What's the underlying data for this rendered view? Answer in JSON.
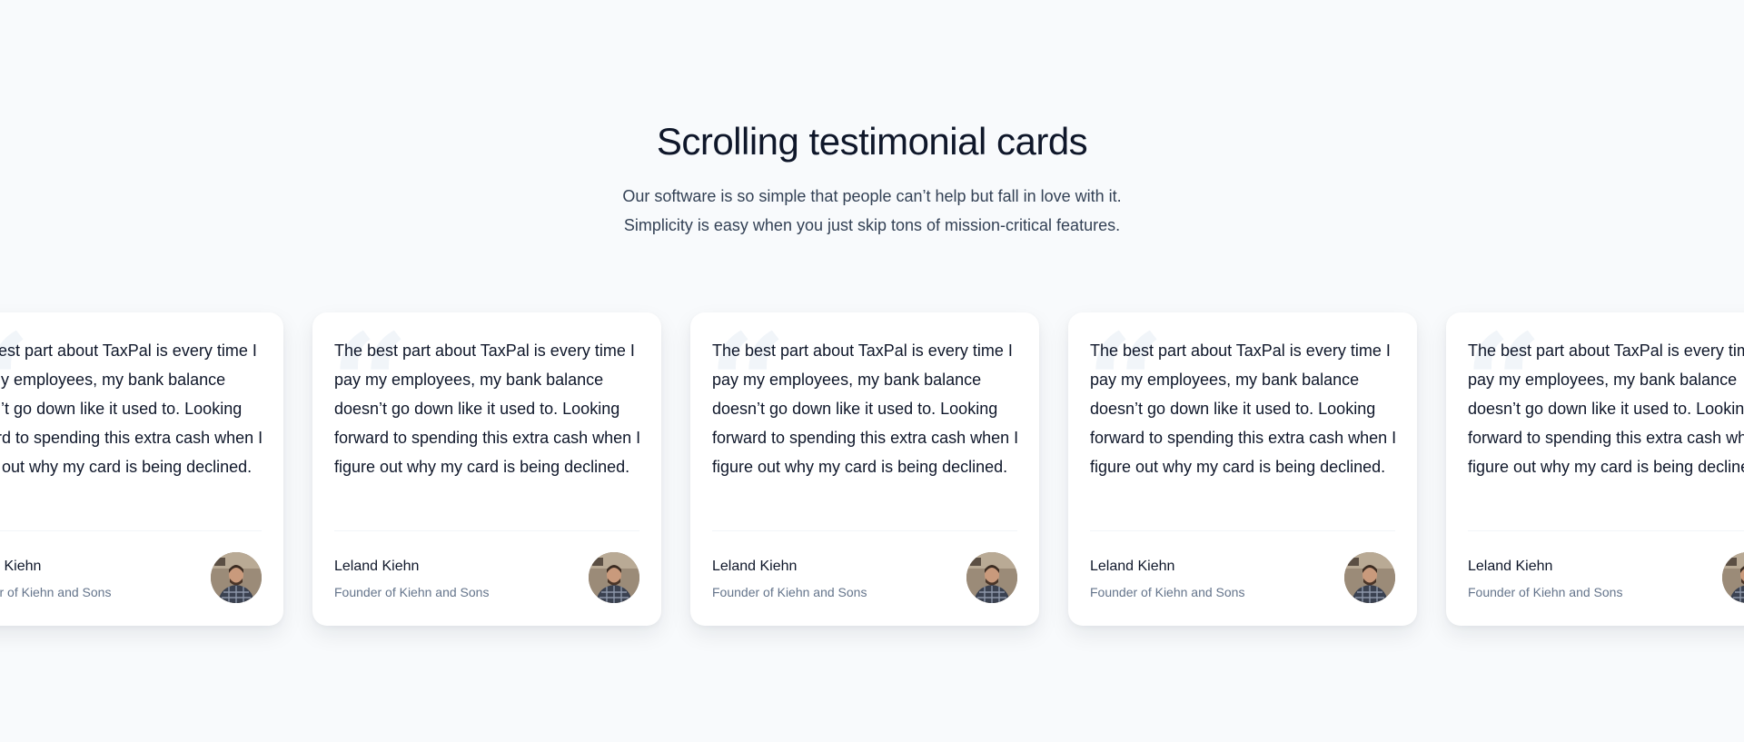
{
  "section": {
    "title": "Scrolling testimonial cards",
    "subtitle_line1": "Our software is so simple that people can’t help but fall in love with it.",
    "subtitle_line2": "Simplicity is easy when you just skip tons of mission-critical features."
  },
  "testimonials": [
    {
      "quote": "The best part about TaxPal is every time I pay my employees, my bank balance doesn’t go down like it used to. Looking forward to spending this extra cash when I figure out why my card is being declined.",
      "author_name": "Leland Kiehn",
      "author_role": "Founder of Kiehn and Sons",
      "avatar_icon": "person-photo"
    },
    {
      "quote": "The best part about TaxPal is every time I pay my employees, my bank balance doesn’t go down like it used to. Looking forward to spending this extra cash when I figure out why my card is being declined.",
      "author_name": "Leland Kiehn",
      "author_role": "Founder of Kiehn and Sons",
      "avatar_icon": "person-photo"
    },
    {
      "quote": "The best part about TaxPal is every time I pay my employees, my bank balance doesn’t go down like it used to. Looking forward to spending this extra cash when I figure out why my card is being declined.",
      "author_name": "Leland Kiehn",
      "author_role": "Founder of Kiehn and Sons",
      "avatar_icon": "person-photo"
    },
    {
      "quote": "The best part about TaxPal is every time I pay my employees, my bank balance doesn’t go down like it used to. Looking forward to spending this extra cash when I figure out why my card is being declined.",
      "author_name": "Leland Kiehn",
      "author_role": "Founder of Kiehn and Sons",
      "avatar_icon": "person-photo"
    },
    {
      "quote": "The best part about TaxPal is every time I pay my employees, my bank balance doesn’t go down like it used to. Looking forward to spending this extra cash when I figure out why my card is being declined.",
      "author_name": "Leland Kiehn",
      "author_role": "Founder of Kiehn and Sons",
      "avatar_icon": "person-photo"
    }
  ],
  "colors": {
    "background": "#f8fafc",
    "card": "#ffffff",
    "heading": "#0f172a",
    "muted": "#64748b",
    "quote_mark": "#f1f5f9"
  }
}
